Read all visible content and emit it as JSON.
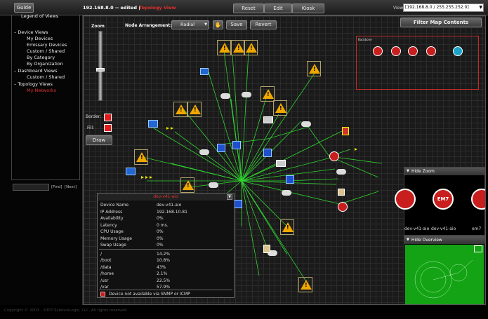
{
  "topbar": {
    "guide_label": "Guide",
    "title_ip": "192.168.8.0 -- edited |",
    "title_view": "Topology View",
    "reset_label": "Reset",
    "edit_label": "Edit",
    "kiosk_label": "Kiosk",
    "view_label": "View:",
    "view_value": "[192.168.8.0 / 255.255.252.0]"
  },
  "sidebar": {
    "items": [
      {
        "label": "Legend of Views",
        "prefix": ""
      },
      {
        "label": "Device Views",
        "prefix": "–"
      },
      {
        "label": "My Devices",
        "prefix": ""
      },
      {
        "label": "Emissary Devices",
        "prefix": ""
      },
      {
        "label": "Custom / Shared",
        "prefix": ""
      },
      {
        "label": "By Category",
        "prefix": ""
      },
      {
        "label": "By Organization",
        "prefix": ""
      },
      {
        "label": "Dashboard Views",
        "prefix": "–"
      },
      {
        "label": "Custom / Shared",
        "prefix": ""
      },
      {
        "label": "Topology Views",
        "prefix": "–"
      },
      {
        "label": "My Networks",
        "prefix": ""
      }
    ],
    "find_label": "[Find]",
    "next_label": "[Next]"
  },
  "controls": {
    "zoom_label": "Zoom",
    "node_arrangement_label": "Node Arrangement:",
    "arrangement_value": "Radial",
    "save_label": "Save",
    "revert_label": "Revert",
    "border_label": "Border:",
    "fill_label": "Fill:",
    "draw_label": "Draw",
    "filter_label": "Filter Map Contents",
    "zoom_level_fraction": 0.55
  },
  "map": {
    "backbone_label": "Backbone"
  },
  "zoompanel": {
    "header": "Hide Zoom",
    "nodes": [
      "dev-v41-aio",
      "dev-v41-aio",
      "em7"
    ],
    "eh_text": "EM7"
  },
  "overview": {
    "header": "Hide Overview"
  },
  "tooltip": {
    "title": "dev-v41-aio",
    "rows": [
      {
        "k": "Device Name",
        "v": "dev-v41-aio"
      },
      {
        "k": "IP Address",
        "v": "192.168.10.81"
      },
      {
        "k": "Availability",
        "v": "0%"
      },
      {
        "k": "Latency",
        "v": "0 ms."
      },
      {
        "k": "CPU Usage",
        "v": "0%"
      },
      {
        "k": "Memory Usage",
        "v": "0%"
      },
      {
        "k": "Swap Usage",
        "v": "0%"
      },
      {
        "k": "/",
        "v": "14.2%"
      },
      {
        "k": "/boot",
        "v": "10.8%"
      },
      {
        "k": "/data",
        "v": "43%"
      },
      {
        "k": "/home",
        "v": "2.1%"
      },
      {
        "k": "/usr",
        "v": "22.5%"
      },
      {
        "k": "/var",
        "v": "57.9%"
      }
    ],
    "warning": "Device not available via SNMP or ICMP"
  },
  "footer": {
    "copyright": "Copyright © 2003 - 2007 ScienceLogic, LLC. All rights reserved."
  },
  "colors": {
    "accent_red": "#e03030",
    "warning": "#f0a800",
    "link_green": "#2fd62f"
  }
}
